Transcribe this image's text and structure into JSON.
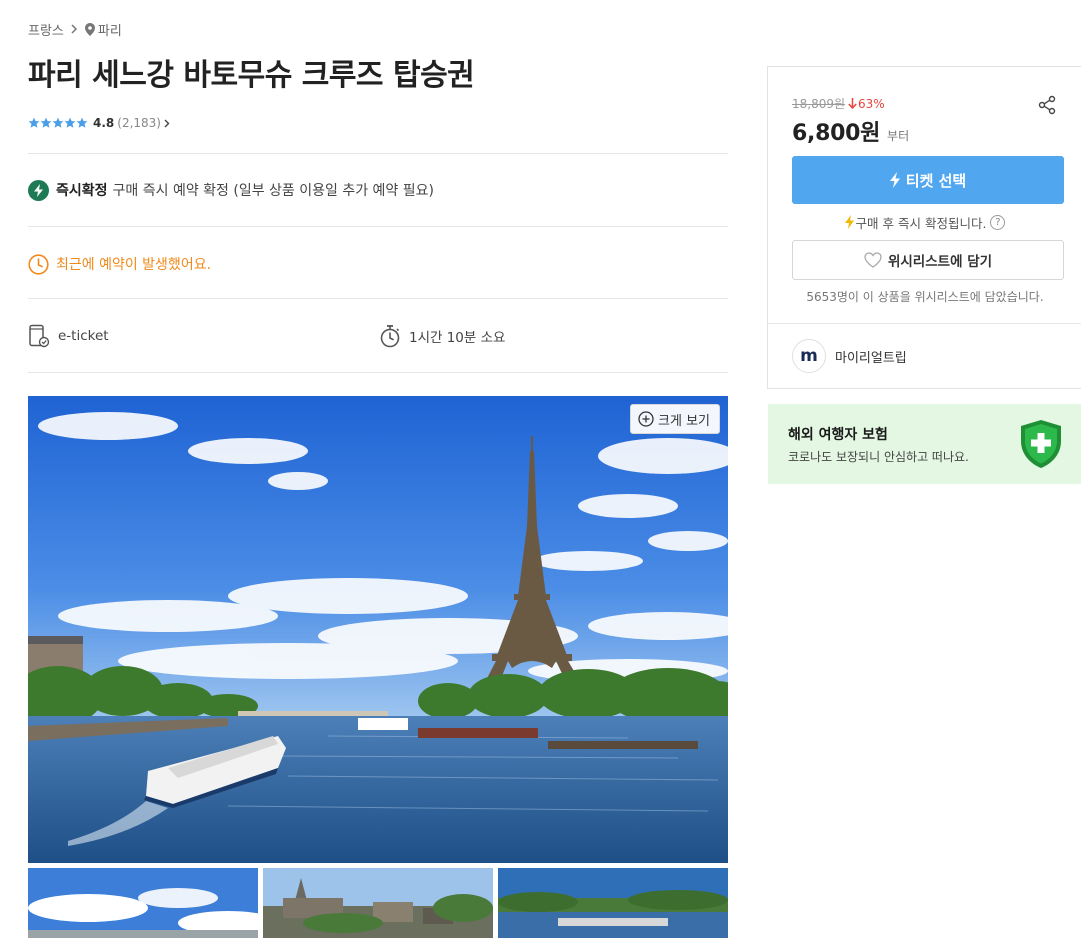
{
  "breadcrumb": {
    "country": "프랑스",
    "city": "파리"
  },
  "product": {
    "title": "파리 세느강 바토무슈 크루즈 탑승권",
    "rating": "4.8",
    "review_count": "(2,183)",
    "stars": 5
  },
  "features": {
    "instant_label": "즉시확정",
    "instant_desc": "구매 즉시 예약 확정 (일부 상품 이용일 추가 예약 필요)",
    "recent_booking": "최근에 예약이 발생했어요.",
    "ticket_type": "e-ticket",
    "duration": "1시간 10분 소요"
  },
  "gallery": {
    "zoom_label": "크게 보기",
    "thumbnail_count": 3
  },
  "purchase": {
    "original_price": "18,809원",
    "discount": "63%",
    "price": "6,800원",
    "price_suffix": "부터",
    "ticket_button": "티켓 선택",
    "confirm_note": "구매 후 즉시 확정됩니다.",
    "help_icon": "?",
    "wishlist_button": "위시리스트에 담기",
    "wishlist_count_text": "5653명이 이 상품을 위시리스트에 담았습니다.",
    "seller_name": "마이리얼트립",
    "seller_logo_text": "m"
  },
  "insurance": {
    "title": "해외 여행자 보험",
    "subtitle": "코로나도 보장되니 안심하고 떠나요."
  },
  "colors": {
    "accent_blue": "#51a6f0",
    "instant_green": "#1e7a55",
    "recent_orange": "#f08a1c",
    "discount_red": "#e8453c",
    "insurance_bg": "#e3f7e3",
    "shield_green": "#2db84b",
    "star_blue": "#4a9ee8"
  },
  "icons": {
    "breadcrumb_separator": "chevron-right-icon",
    "location": "map-pin-icon",
    "instant": "bolt-icon",
    "recent": "clock-icon",
    "ticket": "mobile-ticket-icon",
    "duration": "stopwatch-icon",
    "zoom": "plus-circle-icon",
    "share": "share-icon",
    "wishlist": "heart-icon",
    "insurance": "shield-plus-icon"
  }
}
